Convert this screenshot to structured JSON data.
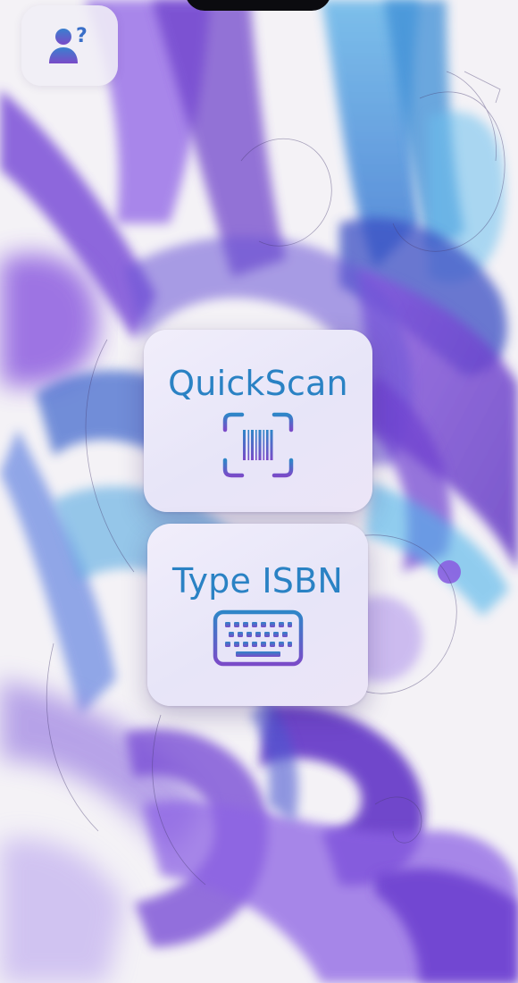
{
  "actions": {
    "quickscan_label": "QuickScan",
    "type_isbn_label": "Type ISBN"
  },
  "icons": {
    "account": "person-question-icon",
    "quickscan": "barcode-viewfinder-icon",
    "type_isbn": "keyboard-icon"
  },
  "colors": {
    "label_blue": "#2a82c4",
    "icon_gradient_start": "#2f86c8",
    "icon_gradient_end": "#7a4bc8",
    "tile_background": "#ece9f8"
  }
}
